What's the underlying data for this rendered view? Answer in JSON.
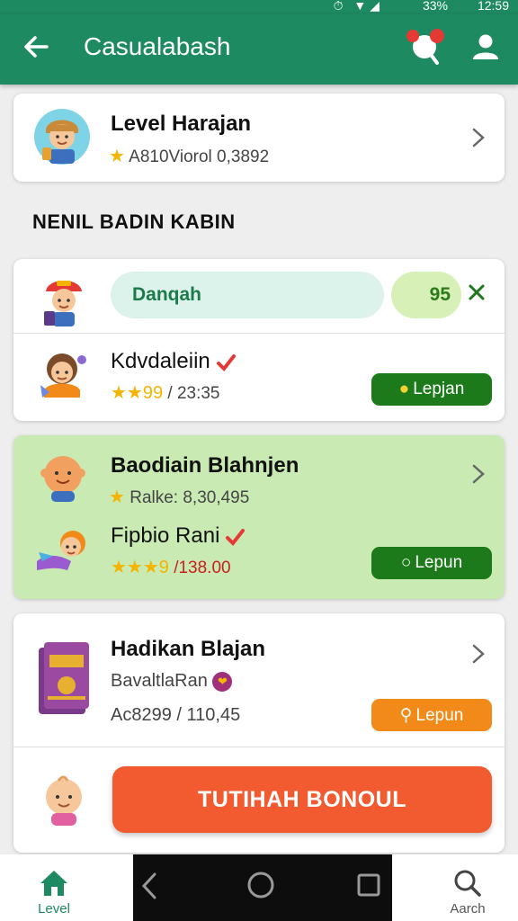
{
  "status_bar": {
    "time": "12:59",
    "battery": "33%"
  },
  "app_bar": {
    "title": "Casualabash"
  },
  "top_card": {
    "name": "Level Harajan",
    "stat": "A810Viorol 0,3892"
  },
  "section": {
    "title": "NENIL BADIN KABIN"
  },
  "card1": {
    "input_text": "Danqah",
    "score": "95",
    "row_name": "Kdvdaleiin",
    "row_stat": "/ 23:35",
    "button_label": "Lepjan"
  },
  "card2": {
    "name": "Baodiain Blahnjen",
    "stat": "Ralke: 8,30,495",
    "row_name": "Fipbio Rani",
    "row_stat": "/138.00",
    "button_label": "Lepun"
  },
  "card3": {
    "name": "Hadikan Blajan",
    "subtitle": "BavaltlaRan",
    "stat": "Ac8299 / 110,45",
    "button_label": "Lepun",
    "big_button_label": "TUTIHAH BONOUL"
  },
  "bottom_nav": {
    "level_label": "Level",
    "search_label": "Aarch"
  },
  "colors": {
    "primary": "#1e8a62",
    "accent_orange": "#f25a30",
    "button_green": "#1d7a1a",
    "card_green": "#c9ebb3"
  }
}
